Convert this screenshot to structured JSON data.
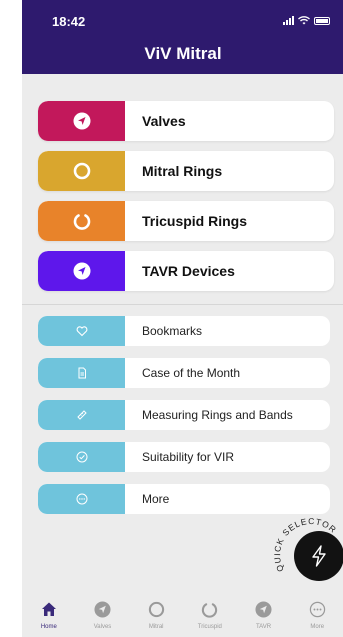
{
  "status": {
    "time": "18:42"
  },
  "header": {
    "title": "ViV Mitral"
  },
  "primary_items": [
    {
      "label": "Valves",
      "icon": "compass-icon",
      "color": "#c2185b"
    },
    {
      "label": "Mitral Rings",
      "icon": "ring-icon",
      "color": "#d9a62e"
    },
    {
      "label": "Tricuspid Rings",
      "icon": "open-ring-icon",
      "color": "#e8832a"
    },
    {
      "label": "TAVR Devices",
      "icon": "compass-icon",
      "color": "#5e17eb"
    }
  ],
  "secondary_items": [
    {
      "label": "Bookmarks",
      "icon": "heart-icon"
    },
    {
      "label": "Case of the Month",
      "icon": "document-icon"
    },
    {
      "label": "Measuring Rings and Bands",
      "icon": "ruler-icon"
    },
    {
      "label": "Suitability for VIR",
      "icon": "check-circle-icon"
    },
    {
      "label": "More",
      "icon": "ellipsis-icon"
    }
  ],
  "quick_selector": {
    "label": "QUICK SELECTOR"
  },
  "tabs": [
    {
      "label": "Home",
      "icon": "home-icon",
      "active": true
    },
    {
      "label": "Valves",
      "icon": "compass-icon"
    },
    {
      "label": "Mitral",
      "icon": "ring-icon"
    },
    {
      "label": "Tricuspid",
      "icon": "open-ring-icon"
    },
    {
      "label": "TAVR",
      "icon": "compass-icon"
    },
    {
      "label": "More",
      "icon": "ellipsis-icon"
    }
  ],
  "colors": {
    "header": "#2e1a6e",
    "secondary_icon_bg": "#6fc4dc",
    "fab": "#121212"
  }
}
